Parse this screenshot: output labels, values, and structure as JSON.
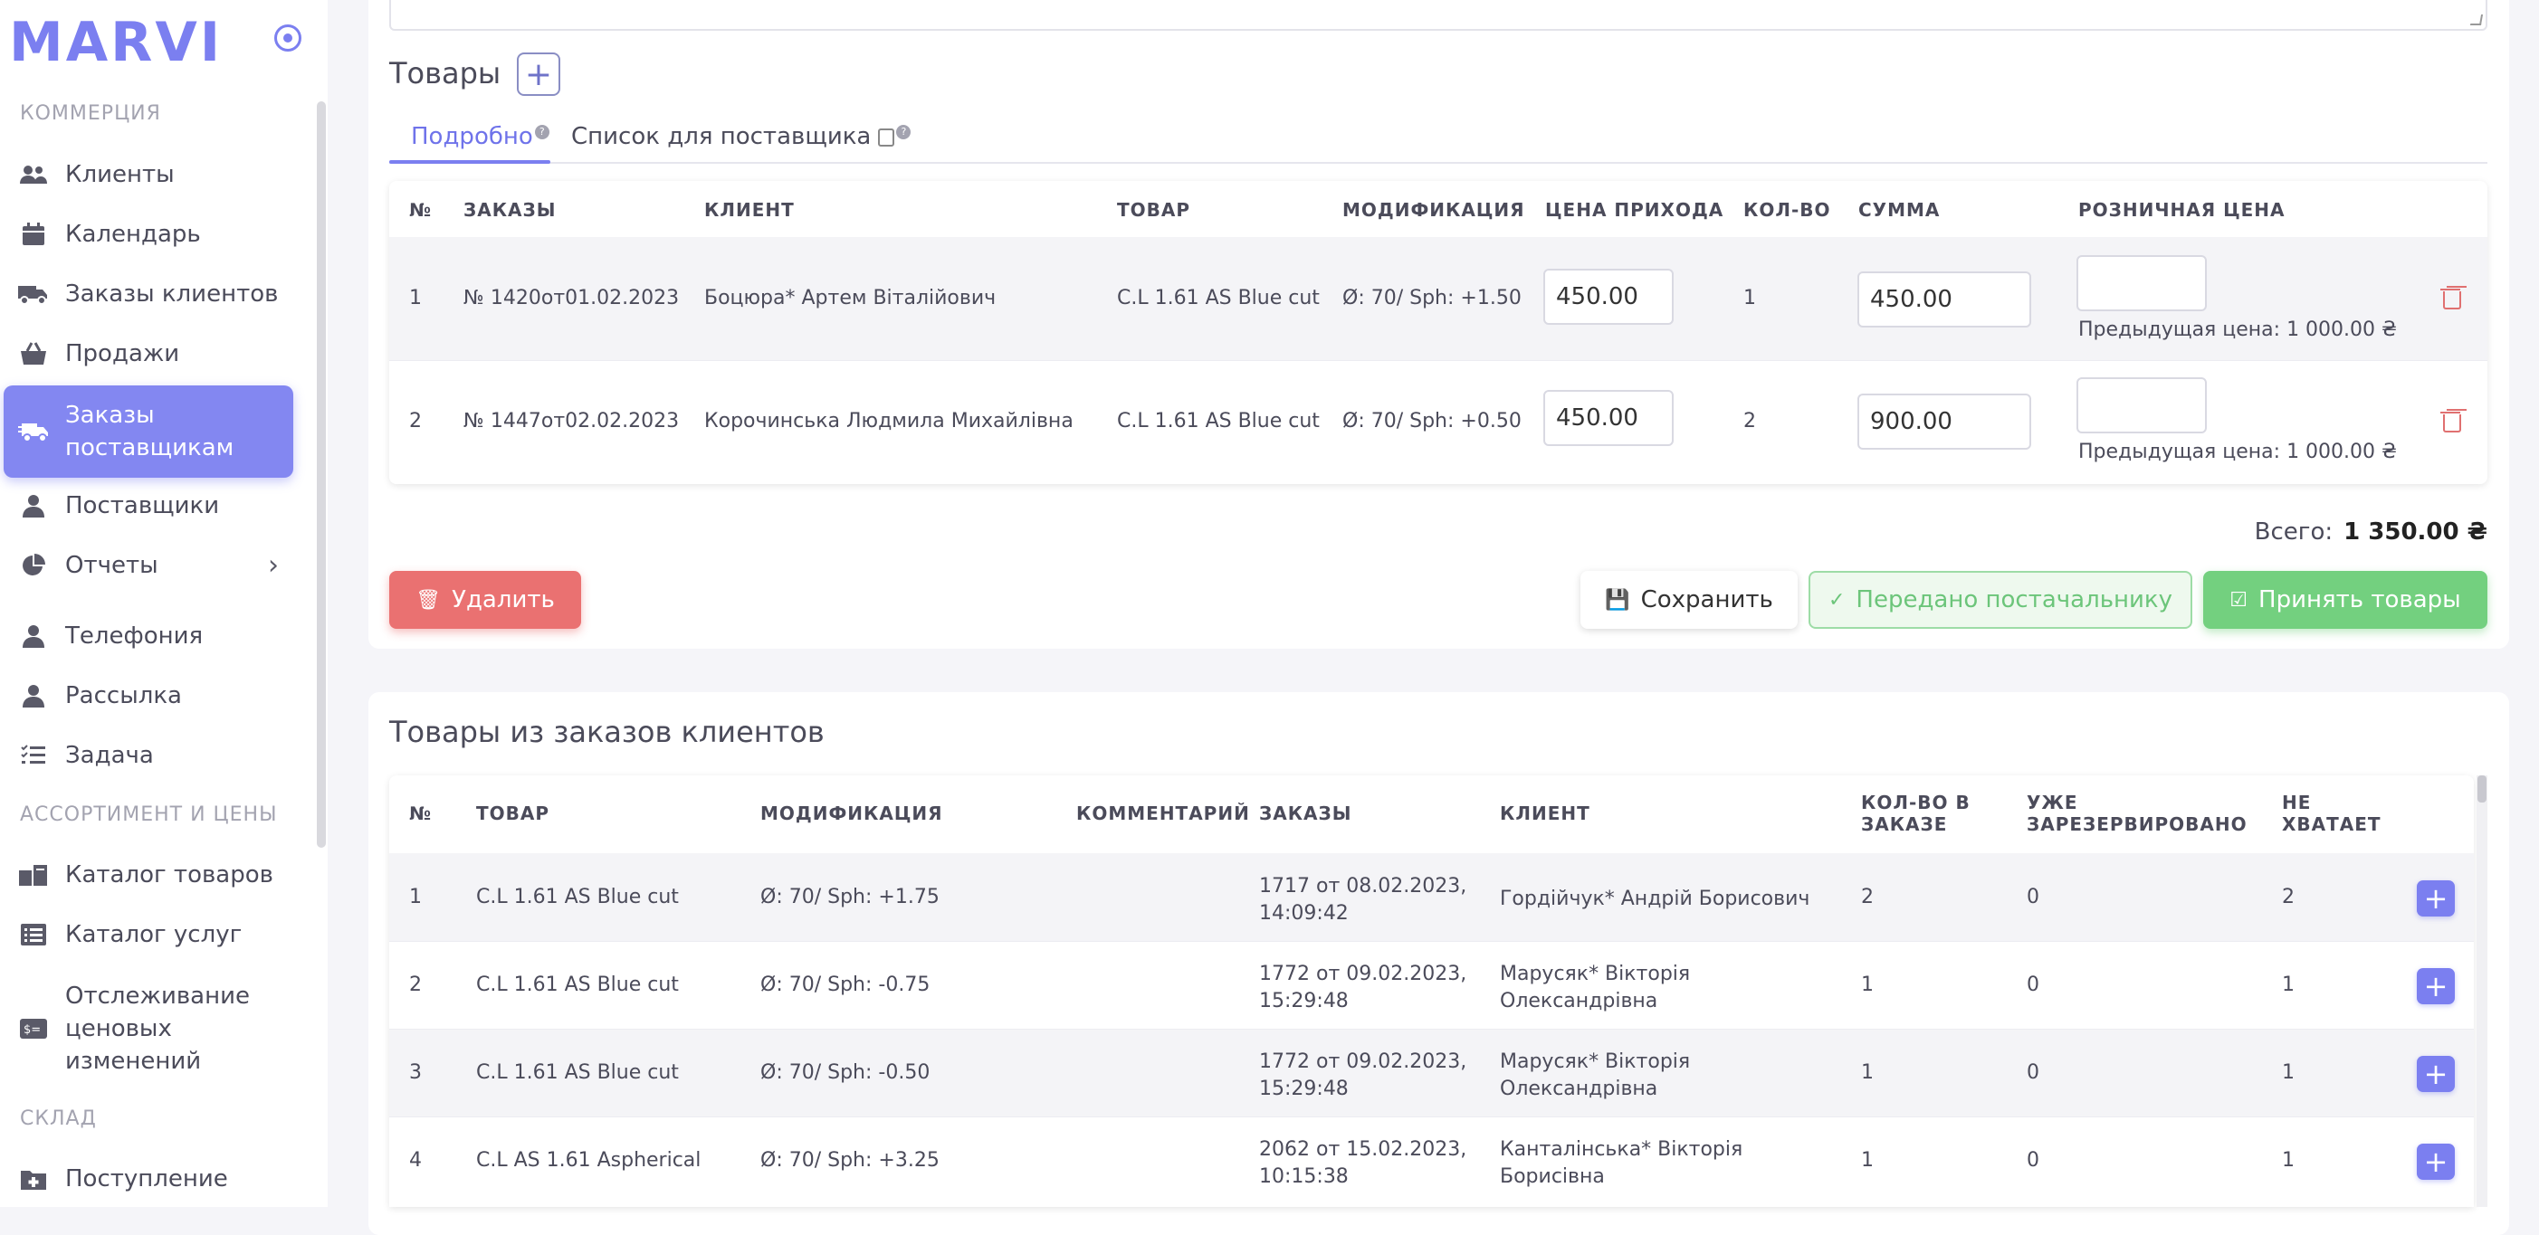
{
  "sidebar": {
    "logo": "MARVI",
    "sections": [
      "КОММЕРЦИЯ",
      "АССОРТИМЕНТ И ЦЕНЫ",
      "СКЛАД"
    ],
    "items": [
      {
        "label": "Клиенты",
        "icon": "users-icon"
      },
      {
        "label": "Календарь",
        "icon": "calendar-icon"
      },
      {
        "label": "Заказы клиентов",
        "icon": "truck-icon"
      },
      {
        "label": "Продажи",
        "icon": "basket-icon"
      },
      {
        "label": "Заказы поставщикам",
        "icon": "truck-fast-icon",
        "active": true
      },
      {
        "label": "Поставщики",
        "icon": "person-icon"
      },
      {
        "label": "Отчеты",
        "icon": "pie-chart-icon"
      },
      {
        "label": "Телефония",
        "icon": "person-icon"
      },
      {
        "label": "Рассылка",
        "icon": "person-icon"
      },
      {
        "label": "Задача",
        "icon": "checklist-icon"
      },
      {
        "label": "Каталог товаров",
        "icon": "boxes-icon"
      },
      {
        "label": "Каталог услуг",
        "icon": "list-icon"
      },
      {
        "label": "Отслеживание ценовых изменений",
        "icon": "money-icon"
      },
      {
        "label": "Поступление",
        "icon": "folder-plus-icon"
      }
    ]
  },
  "goods": {
    "title": "Товары",
    "tabs": [
      "Подробно",
      "Список для поставщика"
    ],
    "columns": [
      "№",
      "ЗАКАЗЫ",
      "КЛИЕНТ",
      "ТОВАР",
      "МОДИФИКАЦИЯ",
      "ЦЕНА ПРИХОДА",
      "КОЛ-ВО",
      "СУММА",
      "РОЗНИЧНАЯ ЦЕНА"
    ],
    "rows": [
      {
        "n": "1",
        "order": "№ 1420от01.02.2023",
        "client": "Боцюра* Артем Віталійович",
        "product": "C.L 1.61 AS Blue cut",
        "mod": "Ø: 70/ Sph: +1.50",
        "price": "450.00",
        "qty": "1",
        "sum": "450.00",
        "retail": "",
        "prev": "Предыдущая цена: 1 000.00 ₴"
      },
      {
        "n": "2",
        "order": "№ 1447от02.02.2023",
        "client": "Корочинська Людмила Михайлівна",
        "product": "C.L 1.61 AS Blue cut",
        "mod": "Ø: 70/ Sph: +0.50",
        "price": "450.00",
        "qty": "2",
        "sum": "900.00",
        "retail": "",
        "prev": "Предыдущая цена: 1 000.00 ₴"
      }
    ],
    "total_label": "Всего:",
    "total_value": "1 350.00 ₴",
    "buttons": {
      "delete": "Удалить",
      "save": "Сохранить",
      "sent": "Передано постачальнику",
      "accept": "Принять товары"
    }
  },
  "client_goods": {
    "title": "Товары из заказов клиентов",
    "columns": [
      "№",
      "ТОВАР",
      "МОДИФИКАЦИЯ",
      "КОММЕНТАРИЙ",
      "ЗАКАЗЫ",
      "КЛИЕНТ",
      "КОЛ-ВО В ЗАКАЗЕ",
      "УЖЕ ЗАРЕЗЕРВИРОВАНО",
      "НЕ ХВАТАЕТ"
    ],
    "columns_wrapped": {
      "qty": [
        "КОЛ-ВО В",
        "ЗАКАЗЕ"
      ],
      "reserved": [
        "УЖЕ",
        "ЗАРЕЗЕРВИРОВАНО"
      ],
      "missing": [
        "НЕ",
        "ХВАТАЕТ"
      ]
    },
    "rows": [
      {
        "n": "1",
        "product": "C.L 1.61 AS Blue cut",
        "mod": "Ø: 70/ Sph: +1.75",
        "comment": "",
        "order1": "1717 от 08.02.2023,",
        "order2": "14:09:42",
        "client1": "Гордійчук* Андрій Борисович",
        "client2": "",
        "qty": "2",
        "reserved": "0",
        "missing": "2"
      },
      {
        "n": "2",
        "product": "C.L 1.61 AS Blue cut",
        "mod": "Ø: 70/ Sph: -0.75",
        "comment": "",
        "order1": "1772 от 09.02.2023,",
        "order2": "15:29:48",
        "client1": "Марусяк* Вікторія",
        "client2": "Олександрівна",
        "qty": "1",
        "reserved": "0",
        "missing": "1"
      },
      {
        "n": "3",
        "product": "C.L 1.61 AS Blue cut",
        "mod": "Ø: 70/ Sph: -0.50",
        "comment": "",
        "order1": "1772 от 09.02.2023,",
        "order2": "15:29:48",
        "client1": "Марусяк* Вікторія",
        "client2": "Олександрівна",
        "qty": "1",
        "reserved": "0",
        "missing": "1"
      },
      {
        "n": "4",
        "product": "C.L AS 1.61 Aspherical",
        "mod": "Ø: 70/ Sph: +3.25",
        "comment": "",
        "order1": "2062 от 15.02.2023,",
        "order2": "10:15:38",
        "client1": "Канталінська* Вікторія",
        "client2": "Борисівна",
        "qty": "1",
        "reserved": "0",
        "missing": "1"
      }
    ]
  },
  "colors": {
    "accent": "#7b7ff0",
    "danger": "#ea7171",
    "success": "#73d07f"
  }
}
